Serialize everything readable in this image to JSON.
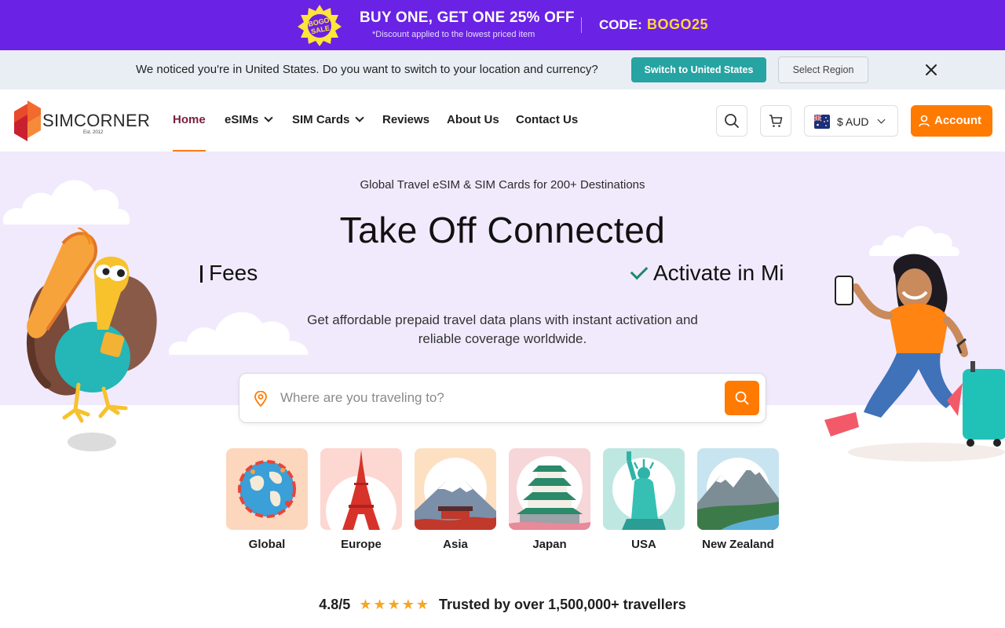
{
  "promo": {
    "badge_line1": "BOGO",
    "badge_line2": "SALE",
    "headline": "BUY ONE, GET ONE 25% OFF",
    "subtext": "*Discount applied to the lowest priced item",
    "code_label": "CODE:",
    "code": "BOGO25"
  },
  "location_bar": {
    "message": "We noticed you're in United States. Do you want to switch to your location and currency?",
    "switch_button": "Switch to United States",
    "region_button": "Select Region",
    "close_icon": "close-icon"
  },
  "header": {
    "logo_text": "SIMCORNER",
    "logo_est": "Est. 2012",
    "nav": [
      {
        "label": "Home",
        "active": true
      },
      {
        "label": "eSIMs",
        "dropdown": true
      },
      {
        "label": "SIM Cards",
        "dropdown": true
      },
      {
        "label": "Reviews"
      },
      {
        "label": "About Us"
      },
      {
        "label": "Contact Us"
      }
    ],
    "search_icon": "search-icon",
    "cart_icon": "cart-icon",
    "currency": "$ AUD",
    "account_button": "Account"
  },
  "hero": {
    "tagline": "Global Travel eSIM & SIM Cards for 200+ Destinations",
    "title": "Take Off Connected",
    "marquee_left": "Fees",
    "marquee_right": "Activate in Mi",
    "description": "Get affordable prepaid travel data plans with instant activation and reliable coverage worldwide.",
    "search_placeholder": "Where are you traveling to?"
  },
  "destinations": [
    {
      "name": "Global"
    },
    {
      "name": "Europe"
    },
    {
      "name": "Asia"
    },
    {
      "name": "Japan"
    },
    {
      "name": "USA"
    },
    {
      "name": "New Zealand"
    }
  ],
  "trust": {
    "rating": "4.8/5",
    "stars": "★★★★★",
    "text": "Trusted by over 1,500,000+ travellers"
  },
  "colors": {
    "promo_bg": "#6a22e4",
    "code_yellow": "#ffd83b",
    "teal_button": "#26a3a3",
    "accent_orange": "#ff7a00",
    "hero_bg": "#f1eafd",
    "nav_active": "#7a1f3d"
  }
}
